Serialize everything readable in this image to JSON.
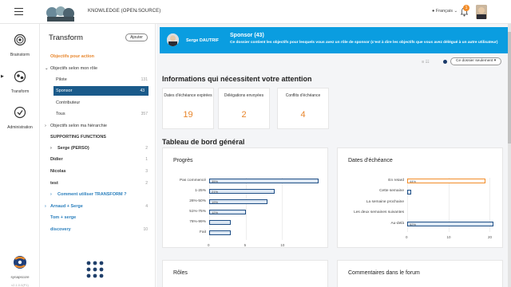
{
  "topbar": {
    "knowledge_title": "KNOWLEDGE (OPEN SOURCE)",
    "language": "Français",
    "notifications_count": "1"
  },
  "leftnav": {
    "items": [
      {
        "label": "Brainstorm"
      },
      {
        "label": "Transform"
      },
      {
        "label": "Administration"
      }
    ],
    "brand": "synapscore",
    "version": "v2.1.0.0(P1)"
  },
  "tree": {
    "title": "Transform",
    "add_label": "Ajouter",
    "rows": [
      {
        "label": "Objectifs pour action",
        "count": ""
      },
      {
        "label": "Objectifs selon mon rôle",
        "count": ""
      },
      {
        "label": "Pilote",
        "count": "131"
      },
      {
        "label": "Sponsor",
        "count": "43"
      },
      {
        "label": "Contributeur",
        "count": ""
      },
      {
        "label": "Tous",
        "count": "357"
      },
      {
        "label": "Objectifs selon ma hiérarchie",
        "count": ""
      },
      {
        "label": "SUPPORTING FUNCTIONS",
        "count": ""
      },
      {
        "label": "Serge (PERSO)",
        "count": "2"
      },
      {
        "label": "Didier",
        "count": "1"
      },
      {
        "label": "Nicolas",
        "count": "3"
      },
      {
        "label": "test",
        "count": "2"
      },
      {
        "label": "Comment utiliser TRANSFORM ?",
        "count": ""
      },
      {
        "label": "Arnaud + Serge",
        "count": "4"
      },
      {
        "label": "Tom + serge",
        "count": ""
      },
      {
        "label": "discovery",
        "count": "10"
      }
    ]
  },
  "banner": {
    "user": "Serge DAUTRIF",
    "title": "Sponsor (43)",
    "description": "Ce dossier contient les objectifs pour lesquels vous avez un rôle de sponsor (c'est à dire les objectifs que vous avez délégué à un autre utilisateur)"
  },
  "filter": {
    "label": "Ce dossier seulement"
  },
  "attention": {
    "title": "Informations qui nécessitent votre attention",
    "cards": [
      {
        "label": "Dates d'échéance expirées",
        "value": "19"
      },
      {
        "label": "Délégations envoyées",
        "value": "2"
      },
      {
        "label": "Conflits d'échéance",
        "value": "4"
      }
    ]
  },
  "dashboard": {
    "title": "Tableau de bord général",
    "cards": {
      "progress": "Progrès",
      "deadlines": "Dates d'échéance",
      "roles": "Rôles",
      "forum": "Commentaires dans le forum"
    }
  },
  "chart_data": [
    {
      "type": "bar",
      "orientation": "horizontal",
      "title": "Progrès",
      "categories": [
        "Pas commencé",
        "1-25%",
        "26%-50%",
        "51%-75%",
        "76%-99%",
        "Fait"
      ],
      "values": [
        15,
        9,
        8,
        5,
        3,
        3
      ],
      "data_labels": [
        "35%",
        "21%",
        "19%",
        "12%",
        "",
        ""
      ],
      "xticks": [
        "0",
        "5",
        "10"
      ],
      "xlim": [
        0,
        15
      ],
      "grid": true
    },
    {
      "type": "bar",
      "orientation": "horizontal",
      "title": "Dates d'échéance",
      "categories": [
        "En retard",
        "Cette semaine",
        "La semaine prochaine",
        "Les deux semaines suivantes",
        "Au-delà"
      ],
      "values": [
        19,
        1,
        0,
        0,
        21
      ],
      "data_labels": [
        "44%",
        "",
        "",
        "",
        "52%"
      ],
      "colors": [
        "#f28c28",
        "#1f4f86",
        "#1f4f86",
        "#1f4f86",
        "#1f4f86"
      ],
      "xticks": [
        "0",
        "10",
        "20"
      ],
      "xlim": [
        0,
        20
      ],
      "grid": true
    }
  ]
}
